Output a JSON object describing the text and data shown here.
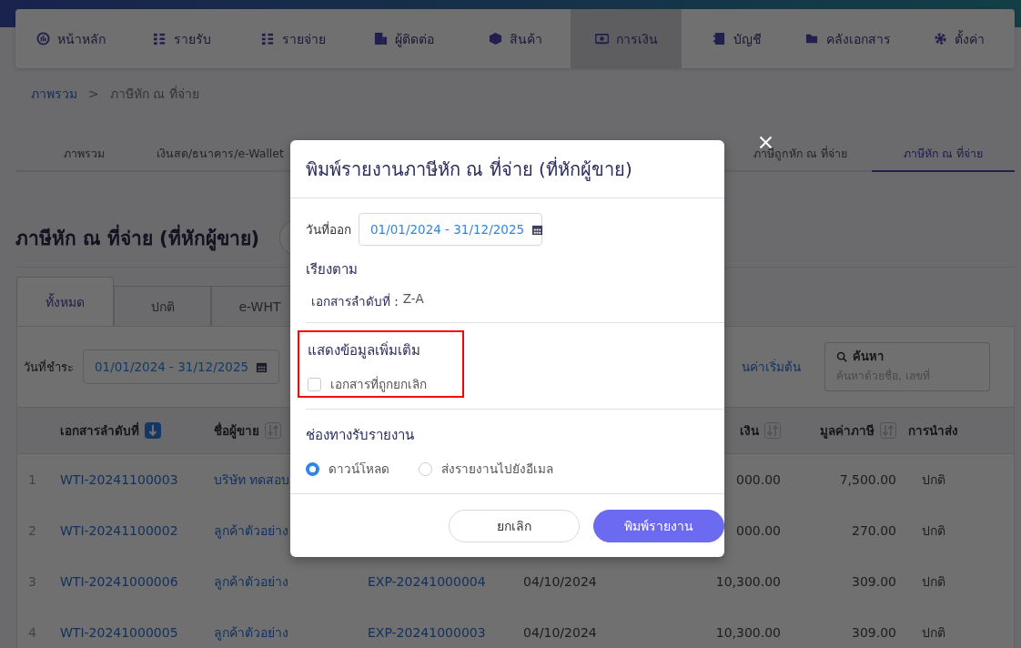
{
  "nav": [
    {
      "label": "หน้าหลัก",
      "selected": false
    },
    {
      "label": "รายรับ",
      "selected": false
    },
    {
      "label": "รายจ่าย",
      "selected": false
    },
    {
      "label": "ผู้ติดต่อ",
      "selected": false
    },
    {
      "label": "สินค้า",
      "selected": false
    },
    {
      "label": "การเงิน",
      "selected": true
    },
    {
      "label": "บัญชี",
      "selected": false
    },
    {
      "label": "คลังเอกสาร",
      "selected": false
    },
    {
      "label": "ตั้งค่า",
      "selected": false
    }
  ],
  "breadcrumb": {
    "parent": "ภาพรวม",
    "separator": ">",
    "current": "ภาษีหัก ณ ที่จ่าย"
  },
  "section_tabs": [
    {
      "label": "ภาพรวม",
      "selected": false
    },
    {
      "label": "เงินสด/ธนาคาร/e-Wallet",
      "selected": false
    },
    {
      "label": "ภาษีถูกหัก ณ ที่จ่าย",
      "selected": false
    },
    {
      "label": "ภาษีหัก ณ ที่จ่าย",
      "selected": true
    }
  ],
  "page_title": "ภาษีหัก ณ ที่จ่าย (ที่หักผู้ขาย)",
  "doc_tabs": [
    {
      "label": "ทั้งหมด",
      "selected": true
    },
    {
      "label": "ปกติ",
      "selected": false
    },
    {
      "label": "e-WHT",
      "selected": false
    }
  ],
  "filter": {
    "date_label": "วันที่ชำระ",
    "date_range": "01/01/2024 - 31/12/2025",
    "reset_link": "นค่าเริ่มต้น",
    "search_label": "ค้นหา",
    "search_placeholder": "ค้นหาด้วยชื่อ, เลขที่"
  },
  "table": {
    "header": {
      "doc_no": {
        "label": "เอกสารลำดับที่",
        "sorted": true
      },
      "seller": {
        "label": "ชื่อผู้ขาย",
        "sorted": false
      },
      "amount": {
        "label": "เงิน",
        "sorted": false
      },
      "tax": {
        "label": "มูลค่าภาษี",
        "sorted": false
      },
      "remittance": {
        "label": "การนำส่ง"
      }
    },
    "rows": [
      {
        "no": "1",
        "doc_no": "WTI-20241100003",
        "seller": "บริษัท ทดสอบ",
        "amount": "000.00",
        "tax": "7,500.00",
        "remittance": "ปกติ"
      },
      {
        "no": "2",
        "doc_no": "WTI-20241100002",
        "seller": "ลูกค้าตัวอย่าง",
        "amount": "000.00",
        "tax": "270.00",
        "remittance": "ปกติ"
      },
      {
        "no": "3",
        "doc_no": "WTI-20241000006",
        "seller": "ลูกค้าตัวอย่าง",
        "ref_doc": "EXP-20241000004",
        "date": "04/10/2024",
        "amount": "10,300.00",
        "tax": "309.00",
        "remittance": "ปกติ"
      },
      {
        "no": "4",
        "doc_no": "WTI-20241000005",
        "seller": "ลูกค้าตัวอย่าง",
        "ref_doc": "EXP-20241000003",
        "date": "04/10/2024",
        "amount": "10,300.00",
        "tax": "309.00",
        "remittance": "ปกติ"
      }
    ]
  },
  "dialog": {
    "title": "พิมพ์รายงานภาษีหัก ณ ที่จ่าย (ที่หักผู้ขาย)",
    "issue_date": {
      "label": "วันที่ออก",
      "value": "01/01/2024 - 31/12/2025"
    },
    "sort": {
      "heading": "เรียงตาม",
      "label": "เอกสารลำดับที่ :",
      "value": "Z-A"
    },
    "extra": {
      "heading": "แสดงข้อมูลเพิ่มเติม",
      "highlighted": true,
      "options": [
        {
          "label": "เอกสารที่ถูกยกเลิก",
          "checked": false
        }
      ]
    },
    "delivery": {
      "heading": "ช่องทางรับรายงาน",
      "options": [
        {
          "label": "ดาวน์โหลด",
          "selected": true
        },
        {
          "label": "ส่งรายงานไปยังอีเมล",
          "selected": false
        }
      ]
    },
    "buttons": [
      {
        "label": "ยกเลิก",
        "kind": "secondary"
      },
      {
        "label": "พิมพ์รายงาน",
        "kind": "primary"
      }
    ]
  }
}
